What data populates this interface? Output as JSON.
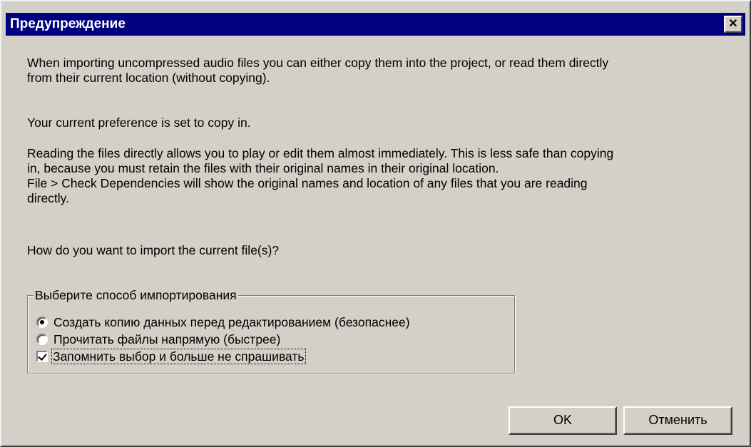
{
  "window": {
    "title": "Предупреждение",
    "close_glyph": "✕"
  },
  "message": {
    "paragraph1": "When importing uncompressed audio files you can either copy them into the project, or read them directly\nfrom their current location (without copying).",
    "paragraph2": "Your current preference is set to copy in.",
    "paragraph3": "Reading the files directly allows you to play or edit them almost immediately.  This is less safe than copying\nin, because you must retain the files with their original names in their original location.\nFile > Check Dependencies will show the original names and location of any files that you are reading\ndirectly.",
    "question": "How do you want to import the current file(s)?"
  },
  "import_group": {
    "legend": "Выберите способ импортирования",
    "options": [
      {
        "label": "Создать копию данных перед редактированием (безопаснее)",
        "selected": true
      },
      {
        "label": "Прочитать файлы напрямую (быстрее)",
        "selected": false
      }
    ],
    "remember": {
      "label": "Запомнить выбор и больше не спрашивать",
      "checked": true
    }
  },
  "buttons": {
    "ok": "OK",
    "cancel": "Отменить"
  },
  "colors": {
    "dialog_bg": "#d4d0c8",
    "titlebar_bg": "#000080",
    "titlebar_text": "#ffffff"
  },
  "icons": {
    "close": "close-icon",
    "radio": "radio-icon",
    "checkbox": "checkbox-icon"
  }
}
